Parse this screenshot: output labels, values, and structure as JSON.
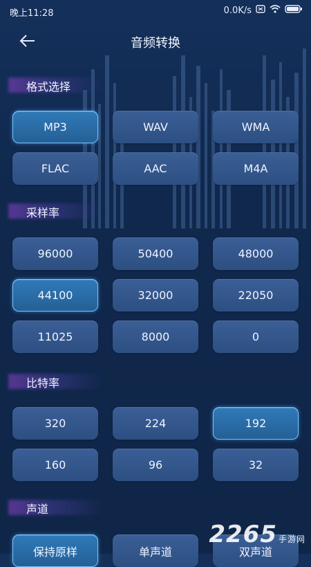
{
  "status": {
    "time": "晚上11:28",
    "speed": "0.0K/s"
  },
  "header": {
    "title": "音频转换"
  },
  "sections": {
    "format": {
      "title": "格式选择",
      "selected": "MP3",
      "options": [
        "MP3",
        "WAV",
        "WMA",
        "FLAC",
        "AAC",
        "M4A"
      ]
    },
    "sample_rate": {
      "title": "采样率",
      "selected": "44100",
      "options": [
        "96000",
        "50400",
        "48000",
        "44100",
        "32000",
        "22050",
        "11025",
        "8000",
        "0"
      ]
    },
    "bit_rate": {
      "title": "比特率",
      "selected": "192",
      "options": [
        "320",
        "224",
        "192",
        "160",
        "96",
        "32"
      ]
    },
    "channel": {
      "title": "声道",
      "selected": "保持原样",
      "options": [
        "保持原样",
        "单声道",
        "双声道"
      ]
    }
  },
  "watermark": {
    "text": "2265",
    "suffix": "手游网"
  },
  "colors": {
    "selected_border": "#78c4ff",
    "button": "#34578c",
    "background": "#12294f"
  }
}
